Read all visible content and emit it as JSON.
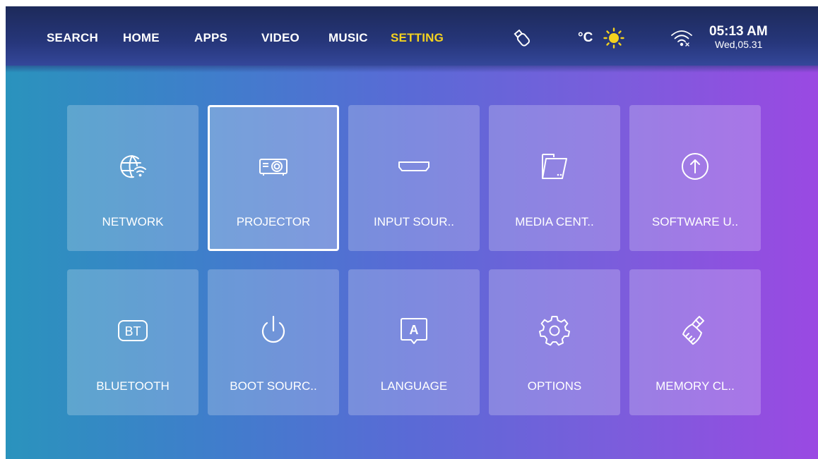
{
  "nav": {
    "items": [
      {
        "label": "SEARCH",
        "active": false
      },
      {
        "label": "HOME",
        "active": false
      },
      {
        "label": "APPS",
        "active": false
      },
      {
        "label": "VIDEO",
        "active": false
      },
      {
        "label": "MUSIC",
        "active": false
      },
      {
        "label": "SETTING",
        "active": true
      }
    ]
  },
  "status": {
    "usb_icon": "usb-drive-icon",
    "temperature_unit": "°C",
    "weather_icon": "sun-icon",
    "wifi_icon": "wifi-disconnected-icon",
    "time": "05:13 AM",
    "date": "Wed,05.31"
  },
  "colors": {
    "active_nav": "#f4d21f",
    "sun": "#f4d21f",
    "focus_border": "#ffffff"
  },
  "settings": {
    "focused_index": 1,
    "tiles": [
      {
        "label": "NETWORK",
        "icon": "globe-wifi-icon"
      },
      {
        "label": "PROJECTOR",
        "icon": "projector-icon"
      },
      {
        "label": "INPUT SOUR..",
        "icon": "hdmi-icon"
      },
      {
        "label": "MEDIA CENT..",
        "icon": "folder-icon"
      },
      {
        "label": "SOFTWARE U..",
        "icon": "upload-arrow-icon"
      },
      {
        "label": "BLUETOOTH",
        "icon": "bluetooth-bt-icon"
      },
      {
        "label": "BOOT SOURC..",
        "icon": "power-icon"
      },
      {
        "label": "LANGUAGE",
        "icon": "language-a-icon"
      },
      {
        "label": "OPTIONS",
        "icon": "gear-icon"
      },
      {
        "label": "MEMORY CL..",
        "icon": "broom-icon"
      }
    ]
  }
}
